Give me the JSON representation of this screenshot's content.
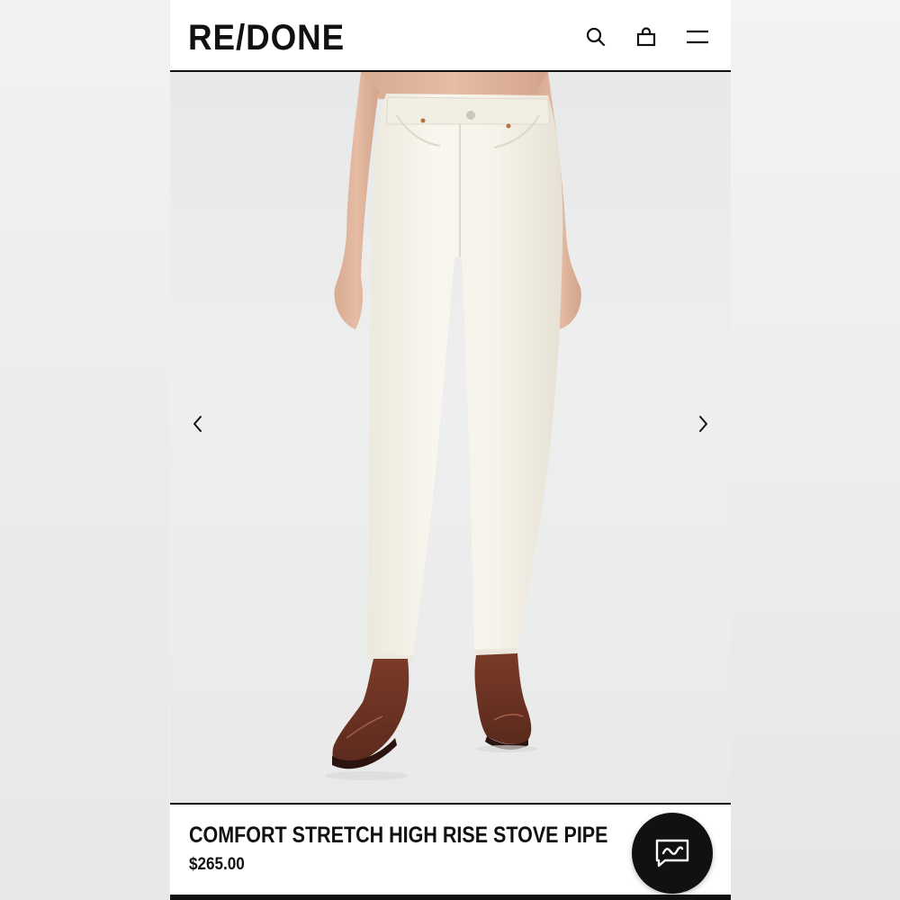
{
  "header": {
    "logo_text": "RE/DONE",
    "icons": [
      "search-icon",
      "shopping-bag-icon",
      "menu-icon"
    ]
  },
  "gallery": {
    "prev_icon": "chevron-left-icon",
    "next_icon": "chevron-right-icon"
  },
  "product": {
    "title": "COMFORT STRETCH HIGH RISE STOVE PIPE",
    "price": "$265.00"
  },
  "chat": {
    "icon": "chat-message-icon"
  },
  "colors": {
    "text": "#111111",
    "background": "#ffffff",
    "jeans": "#f3f0e6",
    "boots": "#6a3122",
    "chat_button": "#111111"
  }
}
